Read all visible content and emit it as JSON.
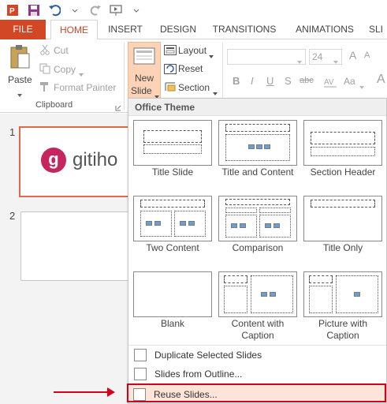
{
  "tabs": {
    "file": "FILE",
    "home": "HOME",
    "insert": "INSERT",
    "design": "DESIGN",
    "transitions": "TRANSITIONS",
    "animations": "ANIMATIONS",
    "slideshow": "SLI"
  },
  "clipboard": {
    "paste": "Paste",
    "cut": "Cut",
    "copy": "Copy",
    "format_painter": "Format Painter",
    "group_label": "Clipboard"
  },
  "slides_group": {
    "new_slide_line1": "New",
    "new_slide_line2": "Slide",
    "layout": "Layout",
    "reset": "Reset",
    "section": "Section"
  },
  "font": {
    "size": "24",
    "bold": "B",
    "italic": "I",
    "underline": "U",
    "shadow": "S",
    "strike": "abc",
    "case": "Aa"
  },
  "slides": {
    "num1": "1",
    "num2": "2",
    "logo_letter": "g",
    "logo_text": "gitiho"
  },
  "dropdown": {
    "header": "Office Theme",
    "layouts": [
      {
        "label": "Title Slide"
      },
      {
        "label": "Title and Content"
      },
      {
        "label": "Section Header"
      },
      {
        "label": "Two Content"
      },
      {
        "label": "Comparison"
      },
      {
        "label": "Title Only"
      },
      {
        "label": "Blank"
      },
      {
        "label_line1": "Content with",
        "label_line2": "Caption"
      },
      {
        "label_line1": "Picture with",
        "label_line2": "Caption"
      }
    ],
    "items": {
      "duplicate": "Duplicate Selected Slides",
      "from_outline": "Slides from Outline...",
      "reuse": "Reuse Slides..."
    }
  },
  "colors": {
    "accent": "#d24726",
    "highlight_border": "#d4001a"
  }
}
